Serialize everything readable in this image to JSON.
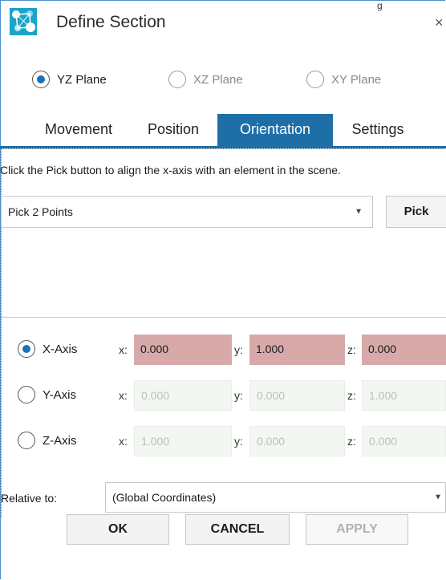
{
  "window": {
    "title": "Define Section",
    "top_clip_text": "g",
    "close_glyph": "×"
  },
  "plane": {
    "options": [
      {
        "label": "YZ Plane",
        "selected": true,
        "enabled": true
      },
      {
        "label": "XZ Plane",
        "selected": false,
        "enabled": false
      },
      {
        "label": "XY Plane",
        "selected": false,
        "enabled": false
      }
    ]
  },
  "tabs": [
    {
      "label": "Movement",
      "active": false
    },
    {
      "label": "Position",
      "active": false
    },
    {
      "label": "Orientation",
      "active": true
    },
    {
      "label": "Settings",
      "active": false
    }
  ],
  "orientation": {
    "hint": "Click the Pick button to align the x-axis with an element in the scene.",
    "pick_mode": "Pick 2 Points",
    "pick_button": "Pick",
    "axes": [
      {
        "label": "X-Axis",
        "selected": true,
        "x": "0.000",
        "y": "1.000",
        "z": "0.000"
      },
      {
        "label": "Y-Axis",
        "selected": false,
        "x": "0.000",
        "y": "0.000",
        "z": "1.000"
      },
      {
        "label": "Z-Axis",
        "selected": false,
        "x": "1.000",
        "y": "0.000",
        "z": "0.000"
      }
    ],
    "coord_labels": {
      "x": "x:",
      "y": "y:",
      "z": "z:"
    },
    "relative_label": "Relative to:",
    "relative_value": "(Global Coordinates)"
  },
  "footer": {
    "ok": "OK",
    "cancel": "CANCEL",
    "apply": "APPLY"
  },
  "colors": {
    "accent": "#1e6ea8",
    "active_field": "#d8a9a9",
    "inactive_field": "#f2f7f2"
  }
}
